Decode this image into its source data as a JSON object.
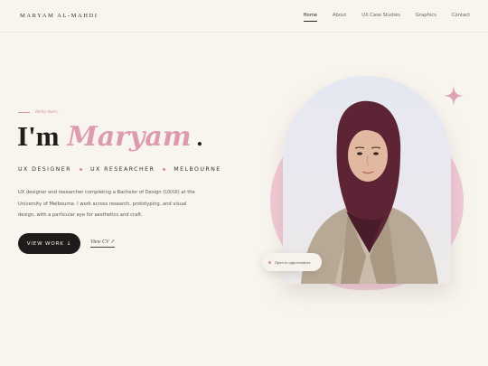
{
  "header": {
    "brand": "MARYAM AL-MAHDI",
    "nav": [
      {
        "label": "Home",
        "active": true
      },
      {
        "label": "About"
      },
      {
        "label": "UX Case Studies"
      },
      {
        "label": "Graphics"
      },
      {
        "label": "Contact"
      }
    ]
  },
  "hero": {
    "greeting": "Hello there,",
    "title_prefix": "I'm",
    "title_name": "Maryam",
    "title_suffix": ".",
    "roles": [
      "UX DESIGNER",
      "UX RESEARCHER",
      "MELBOURNE"
    ],
    "description": "UX designer and researcher completing a Bachelor of Design (UX/UI) at the University of Melbourne. I work across research, prototyping, and visual design, with a particular eye for aesthetics and craft.",
    "primary_button": "VIEW WORK",
    "primary_button_icon": "↓",
    "secondary_link": "View CV ↗"
  },
  "portrait": {
    "badge": "Open to opportunities",
    "sparkle_icon": "four-point-star-icon"
  },
  "colors": {
    "background": "#f8f5ee",
    "accent_pink": "#dc9bb0",
    "dark": "#1f1b1a"
  }
}
